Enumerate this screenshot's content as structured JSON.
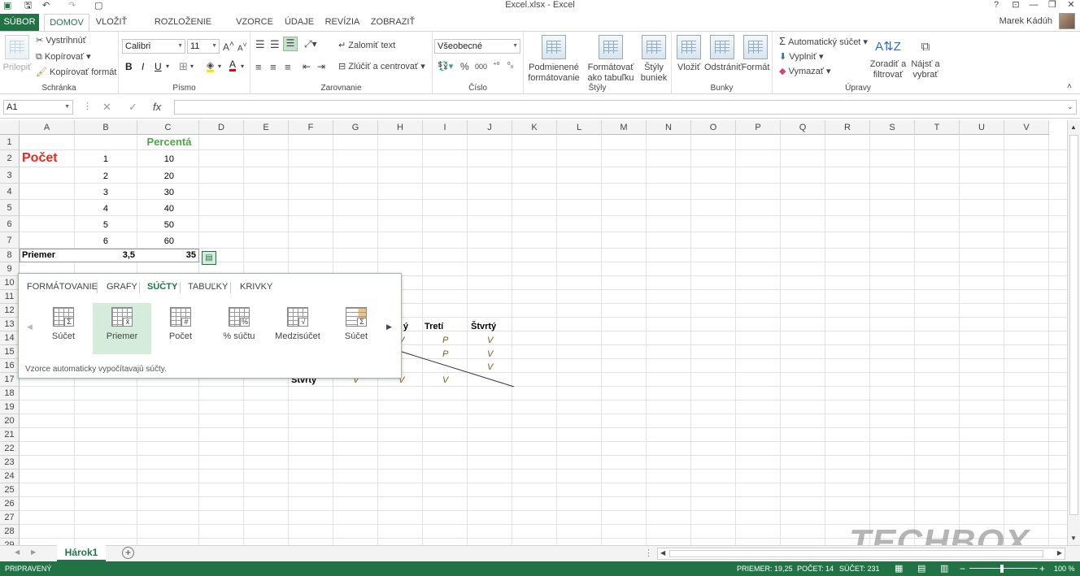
{
  "window": {
    "title": "Excel.xlsx - Excel",
    "user": "Marek Kádúh",
    "help": "?",
    "min": "—",
    "restore": "❐",
    "close": "✕"
  },
  "tabs": [
    "SÚBOR",
    "DOMOV",
    "VLOŽIŤ",
    "ROZLOŽENIE STRANY",
    "VZORCE",
    "ÚDAJE",
    "REVÍZIA",
    "ZOBRAZIŤ"
  ],
  "ribbon": {
    "clipboard": {
      "label": "Schránka",
      "paste": "Prilepiť",
      "cut": "Vystrihnúť",
      "copy": "Kopírovať",
      "format_painter": "Kopírovať formát"
    },
    "font": {
      "label": "Písmo",
      "name": "Calibri",
      "size": "11",
      "bold": "B",
      "italic": "I",
      "underline": "U"
    },
    "alignment": {
      "label": "Zarovnanie",
      "wrap": "Zalomiť text",
      "merge": "Zlúčiť a centrovať"
    },
    "number": {
      "label": "Číslo",
      "format": "Všeobecné",
      "percent": "%",
      "thousands": "000"
    },
    "styles": {
      "label": "Štýly",
      "cond_line1": "Podmienené",
      "cond_line2": "formátovanie",
      "table_line1": "Formátovať",
      "table_line2": "ako tabuľku",
      "cell_line1": "Štýly",
      "cell_line2": "buniek"
    },
    "cells": {
      "label": "Bunky",
      "insert": "Vložiť",
      "delete": "Odstrániť",
      "format": "Formát"
    },
    "editing": {
      "label": "Úpravy",
      "autosum": "Automatický súčet",
      "fill": "Vyplniť",
      "clear": "Vymazať",
      "sort_line1": "Zoradiť a",
      "sort_line2": "filtrovať",
      "find_line1": "Nájsť a",
      "find_line2": "vybrať"
    }
  },
  "formula_bar": {
    "name_box": "A1",
    "fx": "fx",
    "cancel": "✕",
    "enter": "✓"
  },
  "columns": [
    "A",
    "B",
    "C",
    "D",
    "E",
    "F",
    "G",
    "H",
    "I",
    "J",
    "K",
    "L",
    "M",
    "N",
    "O",
    "P",
    "Q",
    "R",
    "S",
    "T",
    "U",
    "V"
  ],
  "rows": [
    "1",
    "2",
    "3",
    "4",
    "5",
    "6",
    "7",
    "8",
    "9",
    "10",
    "11",
    "12",
    "13",
    "14",
    "15",
    "16",
    "17",
    "18",
    "19",
    "20",
    "21",
    "22",
    "23",
    "24",
    "25",
    "26",
    "27",
    "28",
    "29"
  ],
  "cells": {
    "C1": "Percentá",
    "A2": "Počet",
    "B": [
      "1",
      "2",
      "3",
      "4",
      "5",
      "6"
    ],
    "C": [
      "10",
      "20",
      "30",
      "40",
      "50",
      "60"
    ],
    "A8": "Priemer",
    "B8": "3,5",
    "C8": "35",
    "table_headers": [
      "ý",
      "Tretí",
      "Štvrtý"
    ],
    "row14": [
      "V",
      "P",
      "V"
    ],
    "row15": [
      "P",
      "V"
    ],
    "row16": [
      "V"
    ],
    "row17": [
      "Štvrtý",
      "V",
      "V",
      "V"
    ]
  },
  "quick_analysis": {
    "tabs": [
      "FORMÁTOVANIE",
      "GRAFY",
      "SÚČTY",
      "TABUĽKY",
      "KRIVKY"
    ],
    "items": [
      {
        "label": "Súčet",
        "glyph": "Σ"
      },
      {
        "label": "Priemer",
        "glyph": "x̄"
      },
      {
        "label": "Počet",
        "glyph": "#"
      },
      {
        "label": "% súčtu",
        "glyph": "%"
      },
      {
        "label": "Medzisúčet",
        "glyph": "√"
      },
      {
        "label": "Súčet",
        "glyph": "Σ"
      }
    ],
    "footer": "Vzorce automaticky vypočítavajú súčty."
  },
  "sheet": {
    "tab": "Hárok1",
    "add": "+"
  },
  "status": {
    "ready": "PRIPRAVENÝ",
    "average": "PRIEMER: 19,25",
    "count": "POČET: 14",
    "sum": "SÚČET: 231",
    "zoom": "100 %"
  },
  "watermark": "TECHBOX"
}
